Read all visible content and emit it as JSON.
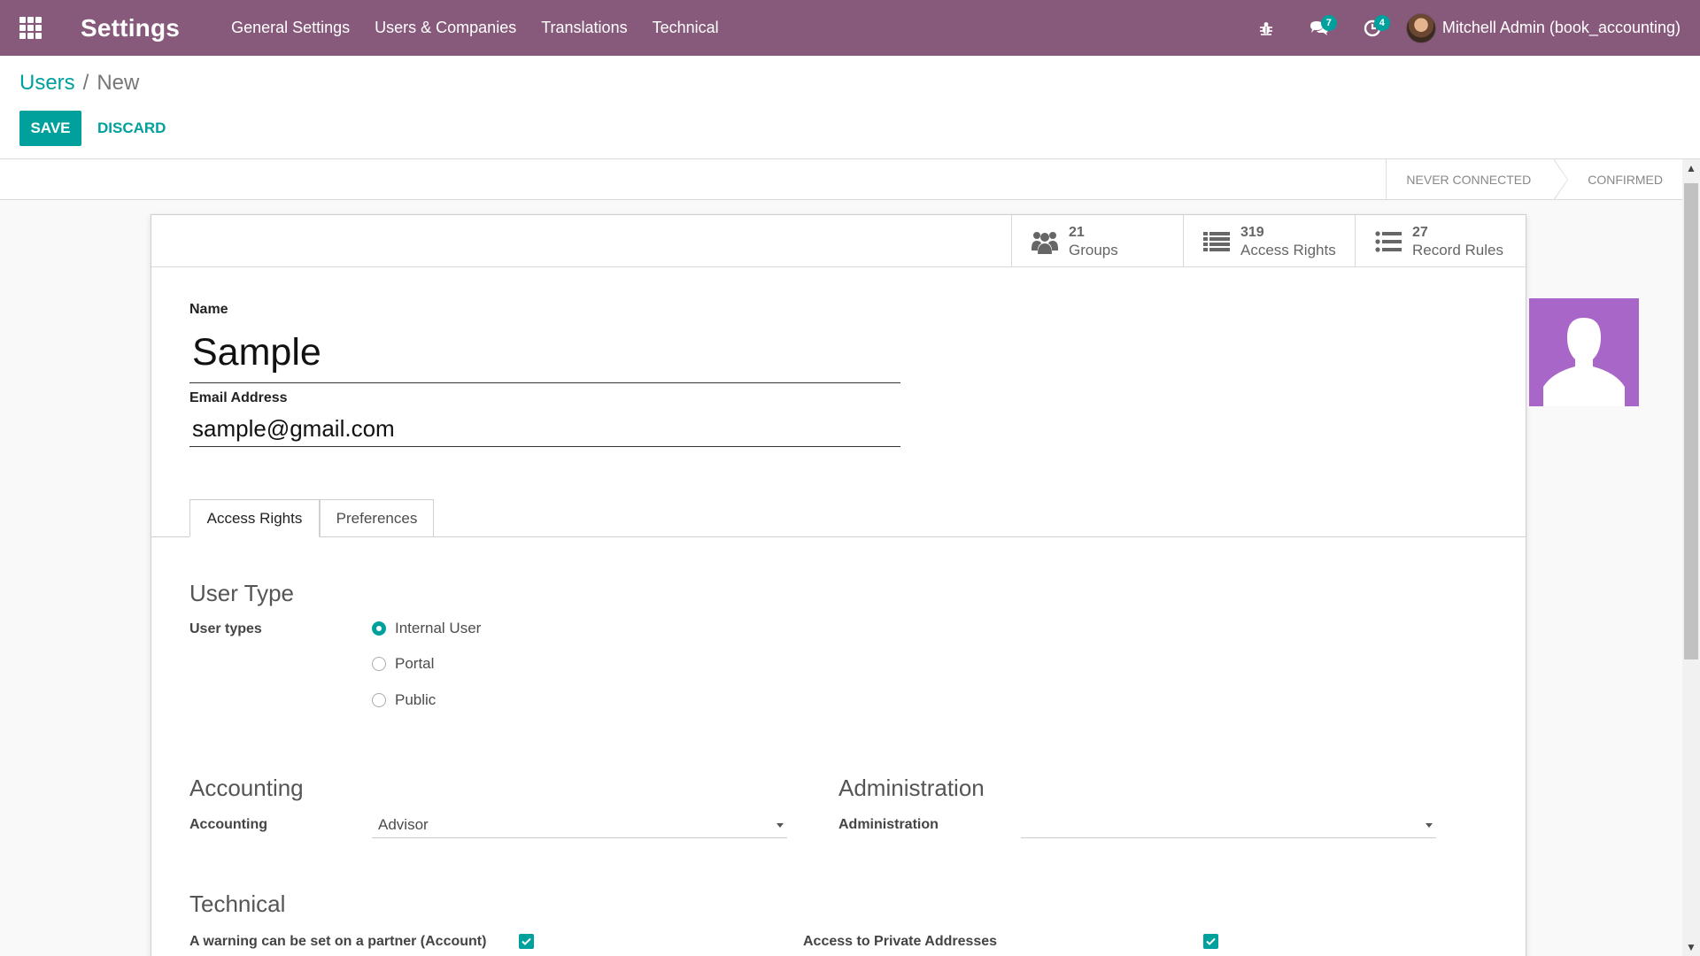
{
  "navbar": {
    "app_title": "Settings",
    "menu": [
      "General Settings",
      "Users & Companies",
      "Translations",
      "Technical"
    ],
    "messages_count": "7",
    "activities_count": "4",
    "user_name": "Mitchell Admin (book_accounting)"
  },
  "breadcrumb": {
    "parent": "Users",
    "separator": "/",
    "current": "New"
  },
  "actions": {
    "save": "SAVE",
    "discard": "DISCARD"
  },
  "status": {
    "steps": [
      "NEVER CONNECTED",
      "CONFIRMED"
    ]
  },
  "smart_buttons": [
    {
      "count": "21",
      "label": "Groups",
      "icon": "users-icon"
    },
    {
      "count": "319",
      "label": "Access Rights",
      "icon": "list-icon"
    },
    {
      "count": "27",
      "label": "Record Rules",
      "icon": "list-icon"
    }
  ],
  "form": {
    "name_label": "Name",
    "name_value": "Sample",
    "email_label": "Email Address",
    "email_value": "sample@gmail.com"
  },
  "tabs": [
    "Access Rights",
    "Preferences"
  ],
  "access": {
    "user_type_title": "User Type",
    "user_types_label": "User types",
    "user_types": [
      {
        "label": "Internal User",
        "checked": true
      },
      {
        "label": "Portal",
        "checked": false
      },
      {
        "label": "Public",
        "checked": false
      }
    ],
    "accounting_title": "Accounting",
    "accounting_label": "Accounting",
    "accounting_value": "Advisor",
    "administration_title": "Administration",
    "administration_label": "Administration",
    "administration_value": "",
    "technical_title": "Technical",
    "technical_fields": [
      {
        "label": "A warning can be set on a partner (Account)",
        "checked": true
      },
      {
        "label": "Access to Private Addresses",
        "checked": true
      }
    ]
  },
  "colors": {
    "brand": "#875a7b",
    "accent": "#00a09d",
    "avatar_bg": "#a867c8"
  }
}
